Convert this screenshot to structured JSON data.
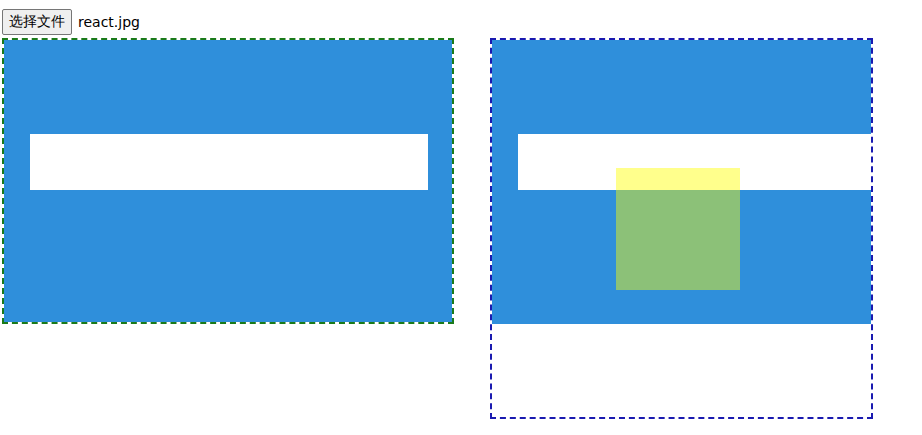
{
  "file_input": {
    "button_label": "选择文件",
    "file_name": "react.jpg"
  },
  "preview": {
    "kind": "image",
    "border_color": "#1a7a1a"
  },
  "crop_canvas": {
    "kind": "image",
    "border_color": "#1a1ab0",
    "selection": {
      "visible": true
    }
  }
}
